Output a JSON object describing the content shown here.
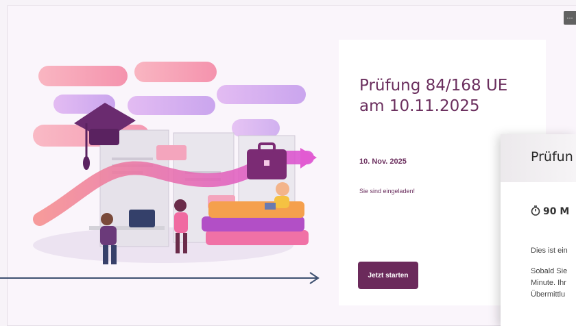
{
  "menu": {
    "more_label": "..."
  },
  "card": {
    "title": "Prüfung 84/168 UE am 10.11.2025",
    "date": "10. Nov. 2025",
    "invite": "Sie sind eingeladen!",
    "start_button": "Jetzt starten"
  },
  "panel": {
    "title": "Prüfun",
    "duration": "90 M",
    "line1": "Dies ist ein",
    "line2": "Sobald Sie",
    "line3": "Minute. Ihr",
    "line4": "Übermittlu"
  },
  "colors": {
    "accent": "#6b2a5b",
    "title_text": "#6b2f5e",
    "background": "#faf5fb"
  },
  "icons": [
    "graduation-cap-icon",
    "briefcase-icon",
    "timer-icon",
    "arrow-right-icon",
    "more-icon"
  ]
}
